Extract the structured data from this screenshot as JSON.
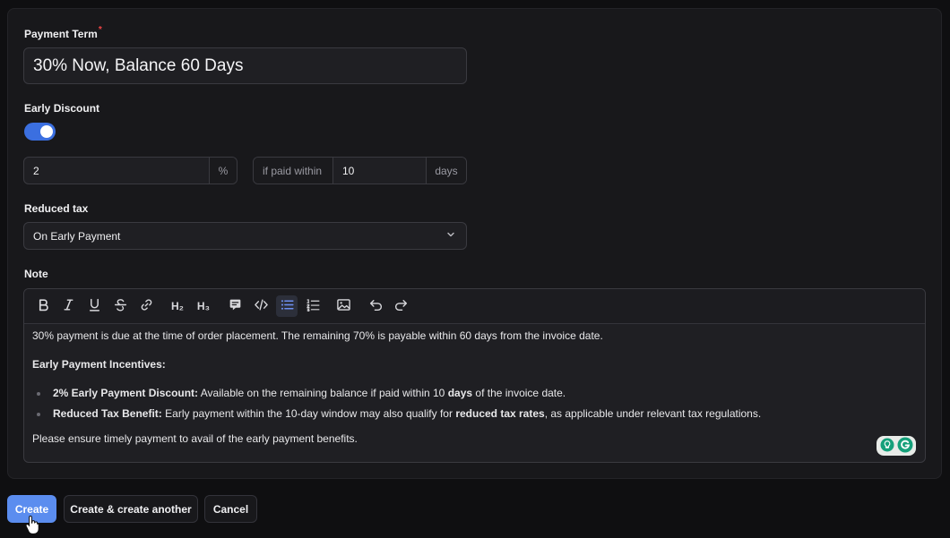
{
  "payment_term": {
    "label": "Payment Term",
    "required_mark": "*",
    "value": "30% Now, Balance 60 Days"
  },
  "early_discount": {
    "label": "Early Discount",
    "enabled": true,
    "percent_value": "2",
    "percent_suffix": "%",
    "if_paid_prefix": "if paid within",
    "days_value": "10",
    "days_suffix": "days"
  },
  "reduced_tax": {
    "label": "Reduced tax",
    "selected": "On Early Payment"
  },
  "note": {
    "label": "Note",
    "toolbar": {
      "h2": "H₂",
      "h3": "H₃"
    },
    "para1": "30% payment is due at the time of order placement. The remaining 70% is payable within 60 days from the invoice date.",
    "heading": "Early Payment Incentives:",
    "bullet1_bold": "2% Early Payment Discount:",
    "bullet1_text_a": " Available on the remaining balance if paid within 10 ",
    "bullet1_bold2": "days",
    "bullet1_text_b": " of the invoice date.",
    "bullet2_bold": "Reduced Tax Benefit:",
    "bullet2_text_a": " Early payment within the 10-day window may also qualify for ",
    "bullet2_bold2": "reduced tax rates",
    "bullet2_text_b": ", as applicable under relevant tax regulations.",
    "para2": "Please ensure timely payment to avail of the early payment benefits."
  },
  "actions": {
    "create": "Create",
    "create_another": "Create & create another",
    "cancel": "Cancel"
  },
  "colors": {
    "accent": "#3b6fe0",
    "primary_button": "#5b8def",
    "required": "#ef4444"
  }
}
